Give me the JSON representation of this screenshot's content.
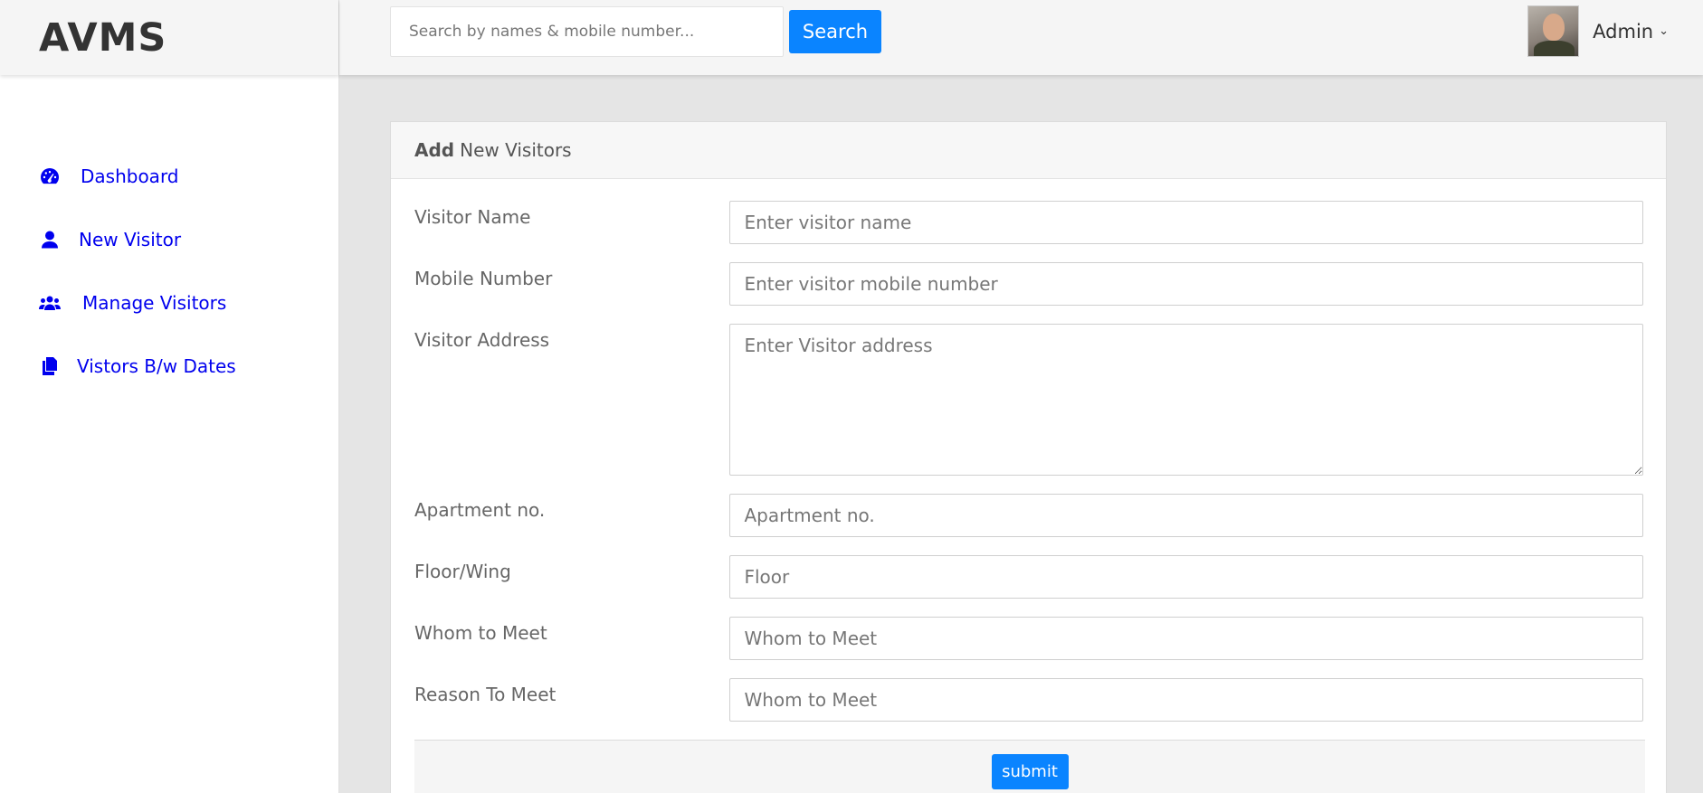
{
  "app": {
    "logo": "AVMS"
  },
  "header": {
    "search_placeholder": "Search by names & mobile number...",
    "search_button": "Search",
    "user_name": "Admin",
    "caret": "⌄"
  },
  "sidebar": {
    "items": [
      {
        "label": "Dashboard",
        "icon": "tachometer-icon"
      },
      {
        "label": "New Visitor",
        "icon": "user-icon"
      },
      {
        "label": "Manage Visitors",
        "icon": "users-icon"
      },
      {
        "label": "Vistors B/w Dates",
        "icon": "files-icon"
      }
    ]
  },
  "form": {
    "title_bold": "Add",
    "title_rest": "New Visitors",
    "fields": [
      {
        "label": "Visitor Name",
        "placeholder": "Enter visitor name"
      },
      {
        "label": "Mobile Number",
        "placeholder": "Enter visitor mobile number"
      },
      {
        "label": "Visitor Address",
        "placeholder": "Enter Visitor address"
      },
      {
        "label": "Apartment no.",
        "placeholder": "Apartment no."
      },
      {
        "label": "Floor/Wing",
        "placeholder": "Floor"
      },
      {
        "label": "Whom to Meet",
        "placeholder": "Whom to Meet"
      },
      {
        "label": "Reason To Meet",
        "placeholder": "Whom to Meet"
      }
    ],
    "submit_label": "submit"
  },
  "colors": {
    "accent": "#0a84ff",
    "nav_link": "#0000ee",
    "background": "#e5e5e5"
  }
}
